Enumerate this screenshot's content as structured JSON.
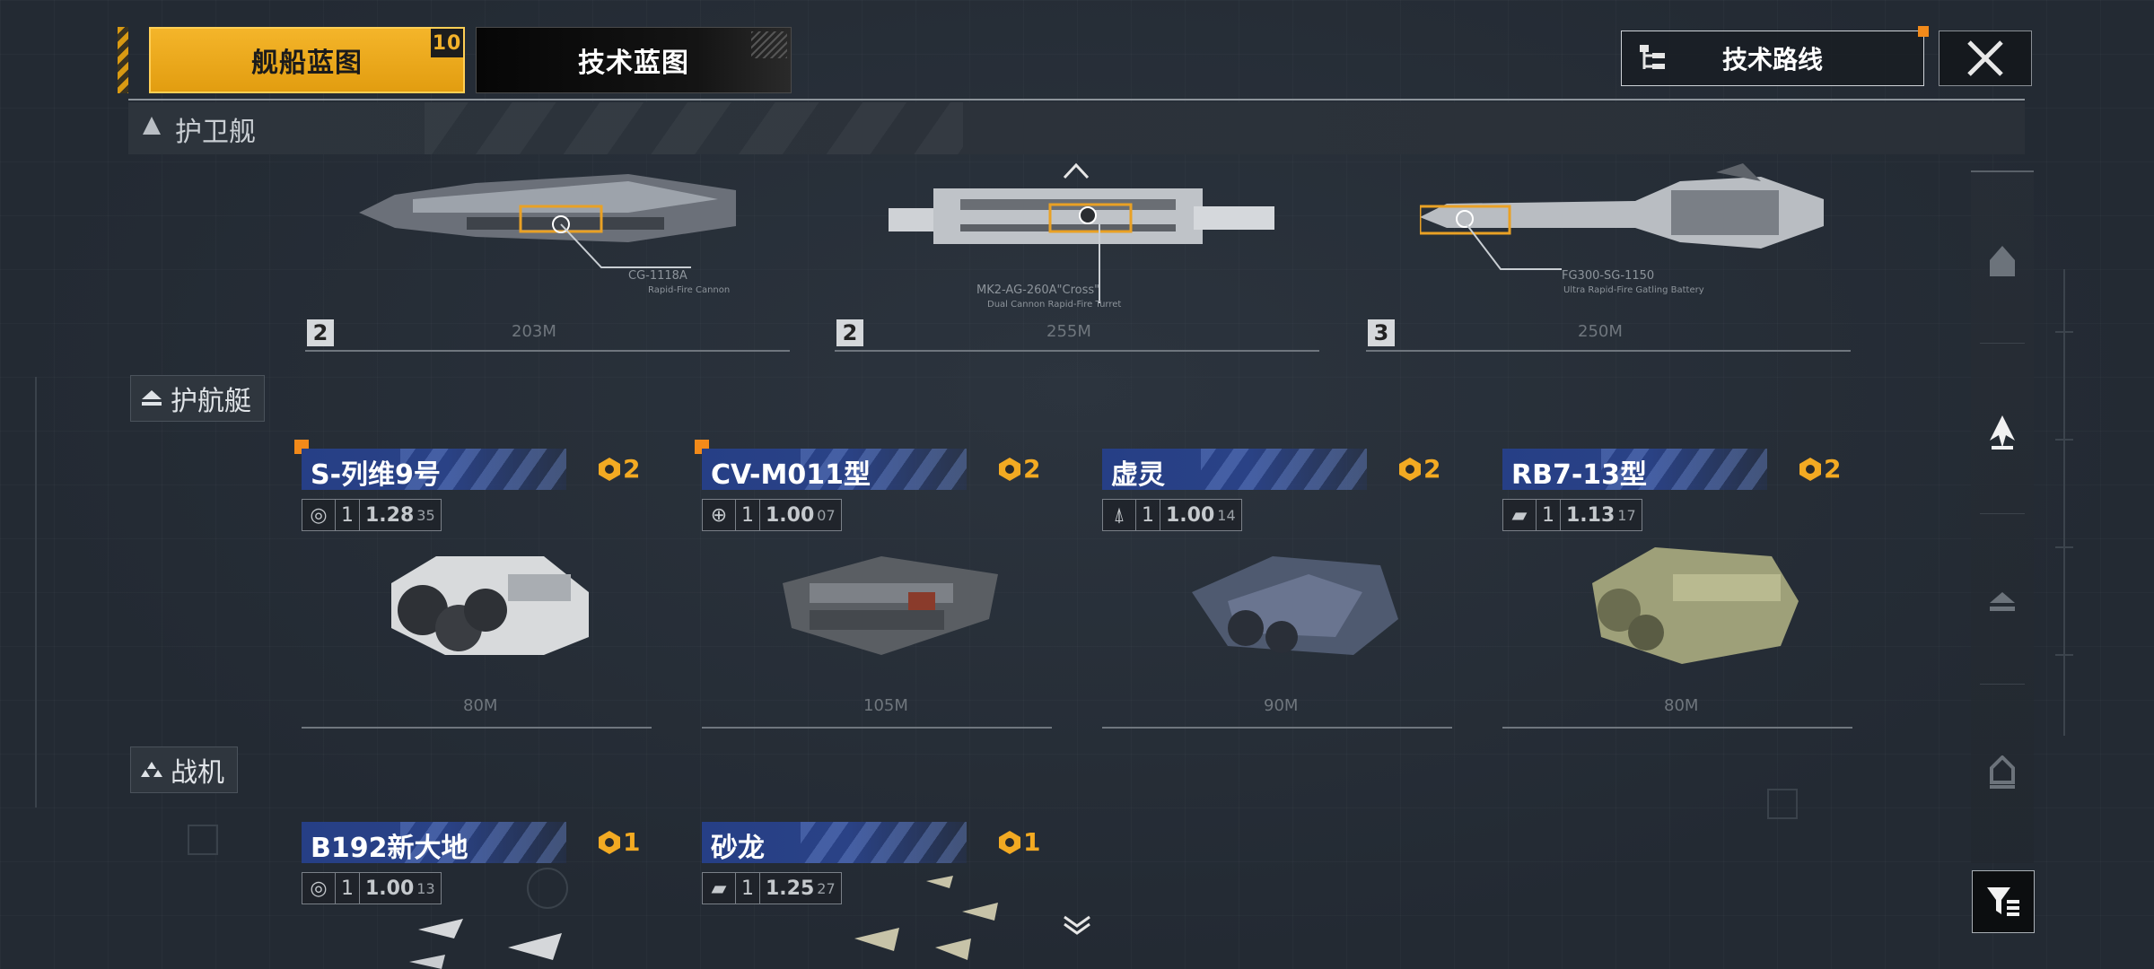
{
  "tabs": {
    "ship_blueprint": "舰船蓝图",
    "ship_blueprint_badge": "10",
    "tech_blueprint": "技术蓝图"
  },
  "top_actions": {
    "tech_route": "技术路线"
  },
  "sections": {
    "frigate": "护卫舰",
    "escort": "护航艇",
    "fighter": "战机"
  },
  "frigates": [
    {
      "count": "2",
      "length": "203M",
      "weapon": "CG-1118A",
      "weapon_sub": "Rapid-Fire Cannon"
    },
    {
      "count": "2",
      "length": "255M",
      "weapon": "MK2-AG-260A\"Cross\"",
      "weapon_sub": "Dual Cannon Rapid-Fire Turret"
    },
    {
      "count": "3",
      "length": "250M",
      "weapon": "FG300-SG-1150",
      "weapon_sub": "Ultra Rapid-Fire Gatling Battery"
    }
  ],
  "escorts": [
    {
      "name": "S-列维9号",
      "cost": "2",
      "level": "1",
      "value": "1.28",
      "sub": "35",
      "length": "80M",
      "is_new": true
    },
    {
      "name": "CV-M011型",
      "cost": "2",
      "level": "1",
      "value": "1.00",
      "sub": "07",
      "length": "105M",
      "is_new": true
    },
    {
      "name": "虚灵",
      "cost": "2",
      "level": "1",
      "value": "1.00",
      "sub": "14",
      "length": "90M",
      "is_new": false
    },
    {
      "name": "RB7-13型",
      "cost": "2",
      "level": "1",
      "value": "1.13",
      "sub": "17",
      "length": "80M",
      "is_new": false
    }
  ],
  "fighters": [
    {
      "name": "B192新大地",
      "cost": "1",
      "level": "1",
      "value": "1.00",
      "sub": "13"
    },
    {
      "name": "砂龙",
      "cost": "1",
      "level": "1",
      "value": "1.25",
      "sub": "27"
    }
  ],
  "colors": {
    "accent": "#f3aa22",
    "title_bar": "#263f86",
    "background": "#232a33"
  },
  "icons": {
    "close": "close-icon",
    "tech_route": "tech-tree-icon",
    "filter": "filter-icon",
    "cost": "hexagon-token-icon"
  }
}
